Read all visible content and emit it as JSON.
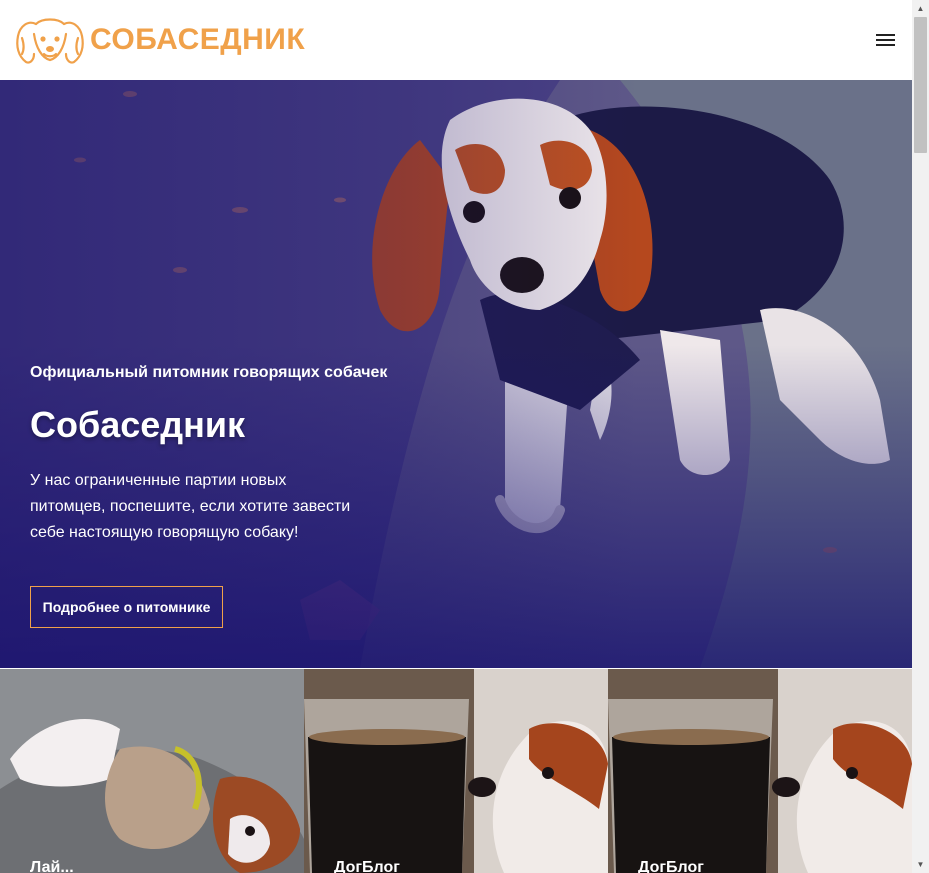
{
  "header": {
    "logo_text": "СОБАСЕДНИК",
    "logo_icon": "spaniel-head-icon",
    "menu_icon": "hamburger-menu-icon"
  },
  "hero": {
    "kicker": "Официальный питомник говорящих собачек",
    "title": "Собаседник",
    "text": "У нас ограниченные партии новых питомцев, поспешите, если хотите завести себе настоящую говорящую собаку!",
    "button_label": "Подробнее о питомнике"
  },
  "cards": [
    {
      "label": "Лай..."
    },
    {
      "label": "ДогБлог"
    },
    {
      "label": "ДогБлог"
    }
  ],
  "colors": {
    "accent": "#f0a14a",
    "hero_overlay": "#26207a"
  },
  "scrollbar": {
    "up_icon": "▲",
    "down_icon": "▼"
  }
}
